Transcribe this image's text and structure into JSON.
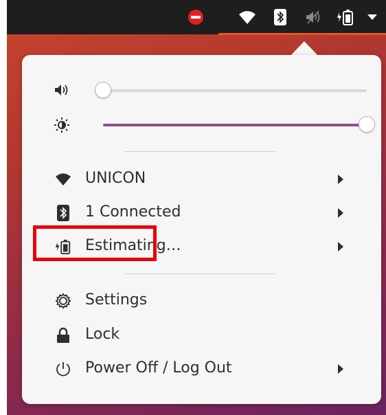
{
  "topbar": {
    "icons": [
      "do-not-disturb-icon",
      "wifi-icon",
      "bluetooth-icon",
      "volume-muted-icon",
      "battery-charging-icon",
      "dropdown-arrow-icon"
    ]
  },
  "sliders": {
    "volume": {
      "level_percent": 0
    },
    "brightness": {
      "level_percent": 100
    }
  },
  "menu": {
    "wifi": {
      "label": "UNICON"
    },
    "bluetooth": {
      "label": "1 Connected"
    },
    "battery": {
      "label": "Estimating…"
    },
    "settings": {
      "label": "Settings"
    },
    "lock": {
      "label": "Lock"
    },
    "power": {
      "label": "Power Off / Log Out"
    }
  },
  "colors": {
    "accent": "#924d8b",
    "topbar_underline": "#e95420",
    "highlight": "#e8000c"
  }
}
